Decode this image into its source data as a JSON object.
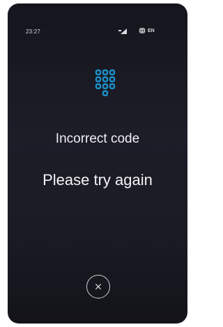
{
  "status_bar": {
    "time": "23:27",
    "signal_icon": "signal-icon",
    "globe_icon": "globe-icon",
    "language": "EN"
  },
  "main": {
    "keypad_icon": "keypad-icon",
    "title": "Incorrect code",
    "subtitle": "Please try again"
  },
  "actions": {
    "close_icon": "close-icon"
  },
  "colors": {
    "accent": "#1a8fc8",
    "background": "#1b1b25",
    "text": "#f0f0f3"
  }
}
